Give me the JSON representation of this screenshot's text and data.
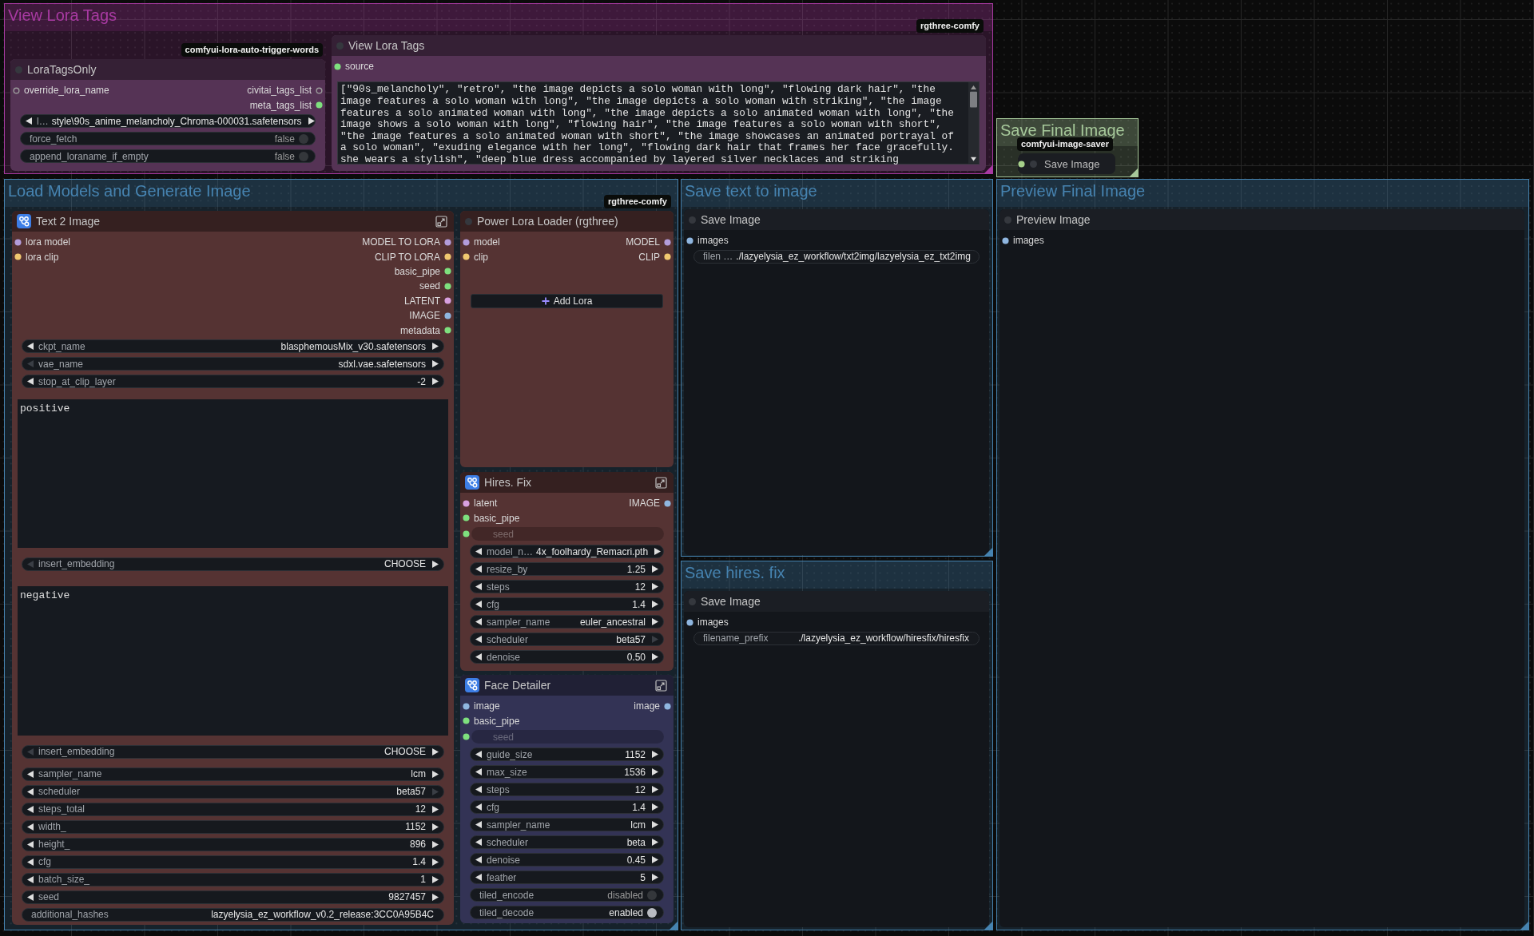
{
  "groups": [
    {
      "title": "View Lora Tags",
      "color": "#a83aa2",
      "nodes": [
        {
          "kind": "node",
          "title": "LoraTagsOnly",
          "color": "#553355",
          "badge": "comfyui-lora-auto-trigger-words",
          "inputs": [
            {
              "label": "override_lora_name",
              "color": "#9a9a9a",
              "connected": false
            }
          ],
          "outputs": [
            {
              "label": "civitai_tags_list",
              "color": "#9a9a9a",
              "connected": false
            },
            {
              "label": "meta_tags_list",
              "color": "#7ee07e",
              "connected": true
            }
          ],
          "widgets": [
            {
              "kind": "combo",
              "label": "l…",
              "value": "style\\90s_anime_melancholy_Chroma-000031.safetensors",
              "prev_disabled": false,
              "next_disabled": false
            },
            {
              "kind": "toggle",
              "label": "force_fetch",
              "value": "false",
              "on": false
            },
            {
              "kind": "toggle",
              "label": "append_loraname_if_empty",
              "value": "false",
              "on": false
            }
          ]
        },
        {
          "kind": "node",
          "title": "View Lora Tags",
          "color": "#553355",
          "badge": "rgthree-comfy",
          "inputs": [
            {
              "label": "source",
              "color": "#7ee07e",
              "connected": true
            }
          ],
          "widgets": [
            {
              "kind": "textarea",
              "value": "[\"90s_melancholy\", \"retro\", \"the image depicts a solo woman with long\", \"flowing dark hair\", \"the image features a solo woman with long\", \"the image depicts a solo woman with striking\", \"the image features a solo animated woman with long\", \"the image depicts a solo animated woman with long\", \"the image shows a solo woman with long\", \"flowing hair\", \"the image features a solo woman with short\", \"the image features a solo animated woman with short\", \"the image showcases an animated portrayal of a solo woman\", \"exuding elegance with her long\", \"flowing dark hair that frames her face gracefully. she wears a stylish\", \"deep blue dress accompanied by layered silver necklaces and striking"
            }
          ]
        }
      ]
    },
    {
      "title": "Save Final Image",
      "color": "#a6c89a",
      "nodes": [
        {
          "kind": "collapsed",
          "title": "Save Image",
          "badge": "comfyui-image-saver",
          "inputs": [
            {
              "color": "#a6d08a",
              "connected": true
            }
          ]
        }
      ]
    },
    {
      "title": "Load Models and Generate Image",
      "color": "#4683b0",
      "nodes": [
        {
          "kind": "subgraph",
          "title": "Text 2 Image",
          "color": "#553333",
          "inputs": [
            {
              "label": "lora model",
              "color": "#b39ddb",
              "connected": true
            },
            {
              "label": "lora clip",
              "color": "#f0c870",
              "connected": true
            }
          ],
          "outputs": [
            {
              "label": "MODEL TO LORA",
              "color": "#b39ddb",
              "connected": true
            },
            {
              "label": "CLIP TO LORA",
              "color": "#f0c870",
              "connected": true
            },
            {
              "label": "basic_pipe",
              "color": "#7ee07e",
              "connected": true
            },
            {
              "label": "seed",
              "color": "#7ee07e",
              "connected": true
            },
            {
              "label": "LATENT",
              "color": "#d8a0e0",
              "connected": true
            },
            {
              "label": "IMAGE",
              "color": "#8fb6e0",
              "connected": true
            },
            {
              "label": "metadata",
              "color": "#7ee07e",
              "connected": true
            }
          ],
          "widgets": [
            {
              "kind": "combo",
              "label": "ckpt_name",
              "value": "blasphemousMix_v30.safetensors",
              "prev_disabled": false,
              "next_disabled": false
            },
            {
              "kind": "combo",
              "label": "vae_name",
              "value": "sdxl.vae.safetensors",
              "prev_disabled": true,
              "next_disabled": false
            },
            {
              "kind": "combo",
              "label": "stop_at_clip_layer",
              "value": "-2",
              "prev_disabled": false,
              "next_disabled": false
            },
            {
              "kind": "textarea",
              "placeholder": "positive"
            },
            {
              "kind": "combo",
              "label": "insert_embedding",
              "value": "CHOOSE",
              "prev_disabled": true,
              "next_disabled": false
            },
            {
              "kind": "textarea",
              "placeholder": "negative"
            },
            {
              "kind": "combo",
              "label": "insert_embedding",
              "value": "CHOOSE",
              "prev_disabled": true,
              "next_disabled": false
            },
            {
              "kind": "combo",
              "label": "sampler_name",
              "value": "lcm",
              "prev_disabled": false,
              "next_disabled": false
            },
            {
              "kind": "combo",
              "label": "scheduler",
              "value": "beta57",
              "prev_disabled": false,
              "next_disabled": true
            },
            {
              "kind": "combo",
              "label": "steps_total",
              "value": "12",
              "prev_disabled": false,
              "next_disabled": false
            },
            {
              "kind": "combo",
              "label": "width_",
              "value": "1152",
              "prev_disabled": false,
              "next_disabled": false
            },
            {
              "kind": "combo",
              "label": "height_",
              "value": "896",
              "prev_disabled": false,
              "next_disabled": false
            },
            {
              "kind": "combo",
              "label": "cfg",
              "value": "1.4",
              "prev_disabled": false,
              "next_disabled": false
            },
            {
              "kind": "combo",
              "label": "batch_size_",
              "value": "1",
              "prev_disabled": false,
              "next_disabled": false
            },
            {
              "kind": "combo",
              "label": "seed",
              "value": "9827457",
              "prev_disabled": false,
              "next_disabled": false
            },
            {
              "kind": "text",
              "label": "additional_hashes",
              "value": "lazyelysia_ez_workflow_v0.2_release:3CC0A95B4C"
            }
          ]
        },
        {
          "kind": "node",
          "title": "Power Lora Loader (rgthree)",
          "color": "#553333",
          "badge": "rgthree-comfy",
          "inputs": [
            {
              "label": "model",
              "color": "#b39ddb",
              "connected": true
            },
            {
              "label": "clip",
              "color": "#f0c870",
              "connected": true
            }
          ],
          "outputs": [
            {
              "label": "MODEL",
              "color": "#b39ddb",
              "connected": true
            },
            {
              "label": "CLIP",
              "color": "#f0c870",
              "connected": true
            }
          ],
          "widgets": [
            {
              "kind": "button",
              "label": "Add Lora"
            }
          ]
        },
        {
          "kind": "subgraph",
          "title": "Hires. Fix",
          "color": "#553333",
          "inputs": [
            {
              "label": "latent",
              "color": "#d8a0e0",
              "connected": true
            },
            {
              "label": "basic_pipe",
              "color": "#7ee07e",
              "connected": true
            }
          ],
          "outputs": [
            {
              "label": "IMAGE",
              "color": "#8fb6e0",
              "connected": true
            }
          ],
          "widgets": [
            {
              "kind": "input",
              "label": "seed",
              "color": "#7ee07e",
              "connected": true
            },
            {
              "kind": "combo",
              "label": "model_n…",
              "value": "4x_foolhardy_Remacri.pth",
              "prev_disabled": false,
              "next_disabled": false
            },
            {
              "kind": "combo",
              "label": "resize_by",
              "value": "1.25",
              "prev_disabled": false,
              "next_disabled": false
            },
            {
              "kind": "combo",
              "label": "steps",
              "value": "12",
              "prev_disabled": false,
              "next_disabled": false
            },
            {
              "kind": "combo",
              "label": "cfg",
              "value": "1.4",
              "prev_disabled": false,
              "next_disabled": false
            },
            {
              "kind": "combo",
              "label": "sampler_name",
              "value": "euler_ancestral",
              "prev_disabled": false,
              "next_disabled": false
            },
            {
              "kind": "combo",
              "label": "scheduler",
              "value": "beta57",
              "prev_disabled": false,
              "next_disabled": true
            },
            {
              "kind": "combo",
              "label": "denoise",
              "value": "0.50",
              "prev_disabled": false,
              "next_disabled": false
            }
          ]
        },
        {
          "kind": "subgraph",
          "title": "Face Detailer",
          "color": "#333355",
          "inputs": [
            {
              "label": "image",
              "color": "#8fb6e0",
              "connected": true
            },
            {
              "label": "basic_pipe",
              "color": "#7ee07e",
              "connected": true
            }
          ],
          "outputs": [
            {
              "label": "image",
              "color": "#8fb6e0",
              "connected": true
            }
          ],
          "widgets": [
            {
              "kind": "input",
              "label": "seed",
              "color": "#7ee07e",
              "connected": true
            },
            {
              "kind": "combo",
              "label": "guide_size",
              "value": "1152",
              "prev_disabled": false,
              "next_disabled": false
            },
            {
              "kind": "combo",
              "label": "max_size",
              "value": "1536",
              "prev_disabled": false,
              "next_disabled": false
            },
            {
              "kind": "combo",
              "label": "steps",
              "value": "12",
              "prev_disabled": false,
              "next_disabled": false
            },
            {
              "kind": "combo",
              "label": "cfg",
              "value": "1.4",
              "prev_disabled": false,
              "next_disabled": false
            },
            {
              "kind": "combo",
              "label": "sampler_name",
              "value": "lcm",
              "prev_disabled": false,
              "next_disabled": false
            },
            {
              "kind": "combo",
              "label": "scheduler",
              "value": "beta",
              "prev_disabled": false,
              "next_disabled": false
            },
            {
              "kind": "combo",
              "label": "denoise",
              "value": "0.45",
              "prev_disabled": false,
              "next_disabled": false
            },
            {
              "kind": "combo",
              "label": "feather",
              "value": "5",
              "prev_disabled": false,
              "next_disabled": false
            },
            {
              "kind": "toggle",
              "label": "tiled_encode",
              "value": "disabled",
              "on": false
            },
            {
              "kind": "toggle",
              "label": "tiled_decode",
              "value": "enabled",
              "on": true
            }
          ]
        }
      ]
    },
    {
      "title": "Save text to image",
      "color": "#4683b0",
      "nodes": [
        {
          "kind": "node",
          "title": "Save Image",
          "inputs": [
            {
              "label": "images",
              "color": "#8fb6e0",
              "connected": true
            }
          ],
          "widgets": [
            {
              "kind": "text",
              "label": "filen …",
              "value": "./lazyelysia_ez_workflow/txt2img/lazyelysia_ez_txt2img"
            }
          ]
        }
      ]
    },
    {
      "title": "Save hires. fix",
      "color": "#4683b0",
      "nodes": [
        {
          "kind": "node",
          "title": "Save Image",
          "inputs": [
            {
              "label": "images",
              "color": "#8fb6e0",
              "connected": true
            }
          ],
          "widgets": [
            {
              "kind": "text",
              "label": "filename_prefix",
              "value": "./lazyelysia_ez_workflow/hiresfix/hiresfix"
            }
          ]
        }
      ]
    },
    {
      "title": "Preview Final Image",
      "color": "#4683b0",
      "nodes": [
        {
          "kind": "node",
          "title": "Preview Image",
          "inputs": [
            {
              "label": "images",
              "color": "#8fb6e0",
              "connected": true
            }
          ]
        }
      ]
    }
  ]
}
